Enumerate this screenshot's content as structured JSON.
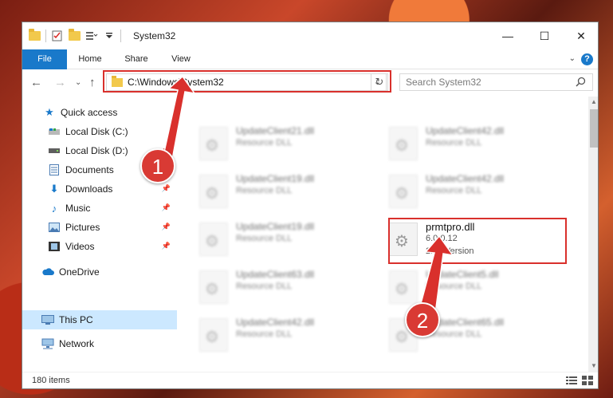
{
  "window": {
    "title": "System32"
  },
  "window_controls": {
    "minimize": "—",
    "maximize": "☐",
    "close": "✕"
  },
  "ribbon": {
    "tabs": [
      "File",
      "Home",
      "Share",
      "View"
    ],
    "help": "?"
  },
  "address_bar": {
    "path": "C:\\Windows\\System32"
  },
  "search": {
    "placeholder": "Search System32"
  },
  "sidebar": {
    "items": [
      {
        "label": "Quick access",
        "icon": "star-icon",
        "pinned": false
      },
      {
        "label": "Local Disk (C:)",
        "icon": "drive-icon",
        "pinned": false
      },
      {
        "label": "Local Disk (D:)",
        "icon": "drive-icon",
        "pinned": true
      },
      {
        "label": "Documents",
        "icon": "documents-icon",
        "pinned": true
      },
      {
        "label": "Downloads",
        "icon": "download-icon",
        "pinned": true
      },
      {
        "label": "Music",
        "icon": "music-icon",
        "pinned": true
      },
      {
        "label": "Pictures",
        "icon": "pictures-icon",
        "pinned": true
      },
      {
        "label": "Videos",
        "icon": "videos-icon",
        "pinned": true
      },
      {
        "label": "OneDrive",
        "icon": "cloud-icon",
        "pinned": false
      },
      {
        "label": "This PC",
        "icon": "computer-icon",
        "pinned": false
      },
      {
        "label": "Network",
        "icon": "network-icon",
        "pinned": false
      }
    ]
  },
  "files": [
    {
      "name": "UpdateClient21.dll",
      "desc": "Resource DLL"
    },
    {
      "name": "UpdateClient42.dll",
      "desc": "Resource DLL"
    },
    {
      "name": "UpdateClient19.dll",
      "desc": "Resource DLL"
    },
    {
      "name": "UpdateClient42.dll",
      "desc": "Resource DLL"
    },
    {
      "name": "UpdateClient19.dll",
      "desc": "Resource DLL"
    },
    {
      "name": "UpdateClient63.dll",
      "desc": "Resource DLL"
    },
    {
      "name": "UpdateClient5.dll",
      "desc": "Resource DLL"
    },
    {
      "name": "UpdateClient42.dll",
      "desc": "Resource DLL"
    },
    {
      "name": "UpdateClient65.dll",
      "desc": "Resource DLL"
    }
  ],
  "highlighted_file": {
    "name": "prmtpro.dll",
    "version": "6.0.0.12",
    "desc": "2FileVersion"
  },
  "status": {
    "item_count": "180 items"
  },
  "annotations": {
    "step1": "1",
    "step2": "2",
    "color": "#d9302c"
  }
}
